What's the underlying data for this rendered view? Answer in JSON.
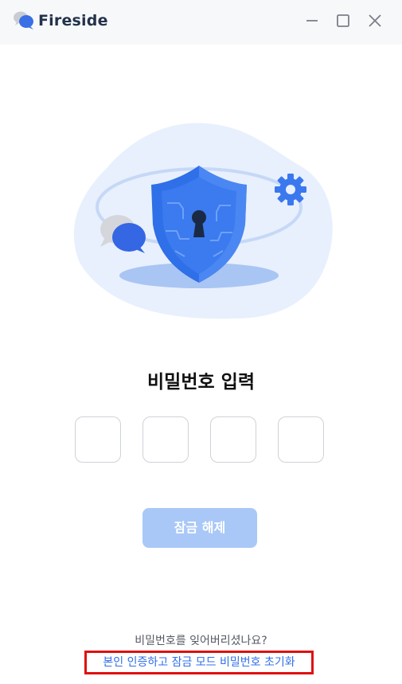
{
  "app": {
    "name": "Fireside"
  },
  "window_controls": {
    "minimize": "minimize-icon",
    "maximize": "maximize-icon",
    "close": "close-icon"
  },
  "illustration": {
    "name": "security-shield-illustration"
  },
  "main": {
    "title": "비밀번호 입력",
    "pin_boxes": [
      "",
      "",
      "",
      ""
    ],
    "unlock_button": "잠금 해제"
  },
  "footer": {
    "forgot_text": "비밀번호를 잊어버리셨나요?",
    "reset_link": "본인 인증하고 잠금 모드 비밀번호 초기화"
  },
  "colors": {
    "accent": "#2f6fe8",
    "button_disabled": "#a9c8f7",
    "highlight_border": "#e01010"
  }
}
